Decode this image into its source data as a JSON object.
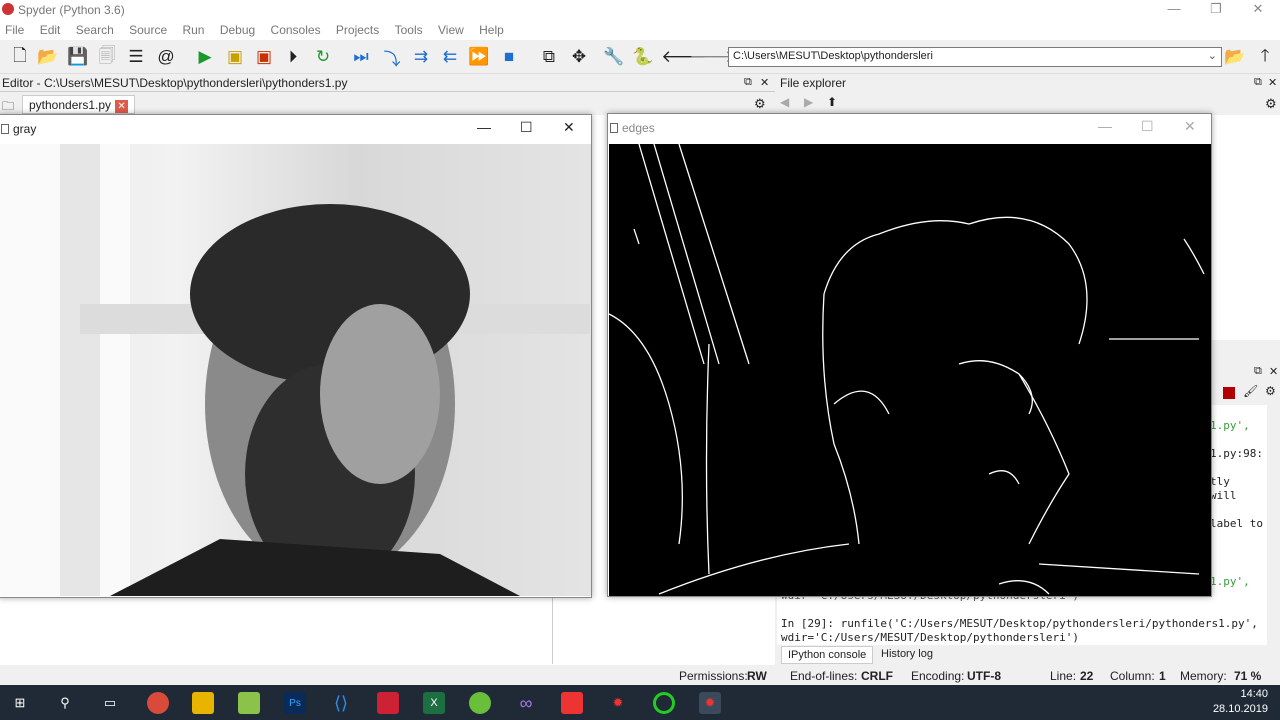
{
  "window": {
    "title": "Spyder (Python 3.6)",
    "controls": [
      "—",
      "❐",
      "✕"
    ]
  },
  "menu": [
    "File",
    "Edit",
    "Search",
    "Source",
    "Run",
    "Debug",
    "Consoles",
    "Projects",
    "Tools",
    "View",
    "Help"
  ],
  "toolbar": {
    "path": "C:\\Users\\MESUT\\Desktop\\pythondersleri"
  },
  "editor": {
    "header": "Editor - C:\\Users\\MESUT\\Desktop\\pythondersleri\\pythonders1.py",
    "tab": "pythonders1.py"
  },
  "file_explorer": {
    "header": "File explorer"
  },
  "console": {
    "lines": [
      {
        "t": "1.py',",
        "c": "green"
      },
      {
        "t": "1.py:98:",
        "c": ""
      },
      {
        "t": "tly",
        "c": ""
      },
      {
        "t": "will",
        "c": ""
      },
      {
        "t": "label to",
        "c": ""
      },
      {
        "t": "1.py',",
        "c": "green"
      },
      {
        "t": "wdir='C:/Users/MESUT/Desktop/pythondersleri')",
        "c": ""
      },
      {
        "t": "",
        "c": ""
      },
      {
        "t": "In [29]: runfile('C:/Users/MESUT/Desktop/pythondersleri/pythonders1.py',",
        "c": ""
      },
      {
        "t": "wdir='C:/Users/MESUT/Desktop/pythondersleri')",
        "c": ""
      }
    ],
    "tabs": [
      "IPython console",
      "History log"
    ]
  },
  "status": {
    "permissions_label": "Permissions:",
    "permissions": "RW",
    "eol_label": "End-of-lines:",
    "eol": "CRLF",
    "encoding_label": "Encoding:",
    "encoding": "UTF-8",
    "line_label": "Line:",
    "line": "22",
    "column_label": "Column:",
    "column": "1",
    "memory_label": "Memory:",
    "memory": "71 %"
  },
  "gray_window": {
    "title": "gray"
  },
  "edges_window": {
    "title": "edges"
  },
  "taskbar": {
    "time": "14:40",
    "date": "28.10.2019"
  }
}
